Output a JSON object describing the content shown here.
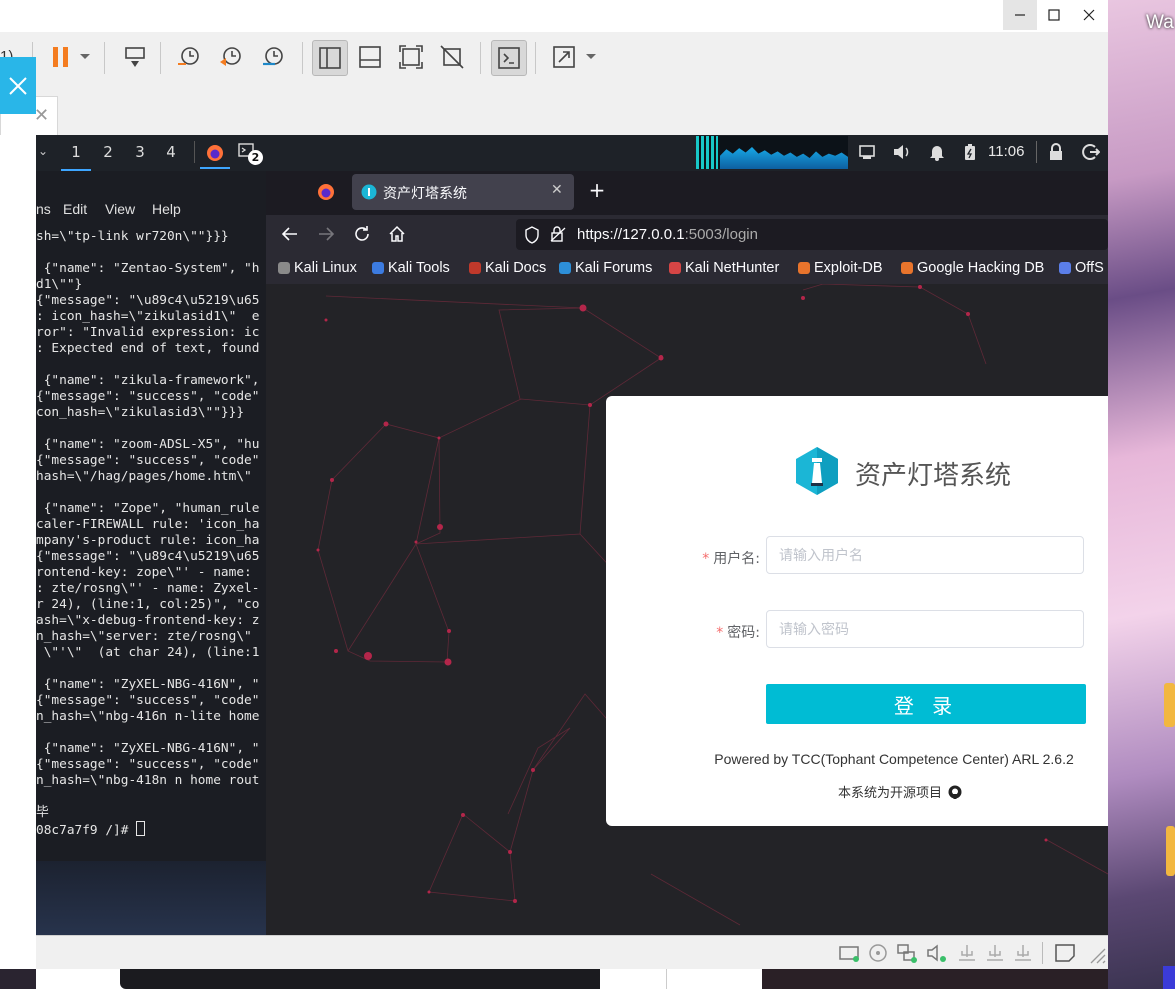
{
  "wallpaper": {
    "text": "Wa"
  },
  "vmware": {
    "toolbar": {
      "partial_label": "1)"
    },
    "statusbar": {}
  },
  "kali_panel": {
    "workspaces": [
      "1",
      "2",
      "3",
      "4"
    ],
    "terminal_badge": "2",
    "clock": "11:06"
  },
  "terminal": {
    "menu": [
      "ns",
      "Edit",
      "View",
      "Help"
    ],
    "lines": [
      "sh=\\\"tp-link wr720n\\\"\"}}}",
      "",
      " {\"name\": \"Zentao-System\", \"h",
      "d1\\\"\"}",
      "{\"message\": \"\\u89c4\\u5219\\u65",
      ": icon_hash=\\\"zikulasid1\\\"  e",
      "ror\": \"Invalid expression: ic",
      ": Expected end of text, found",
      "",
      " {\"name\": \"zikula-framework\",",
      "{\"message\": \"success\", \"code\"",
      "con_hash=\\\"zikulasid3\\\"\"}}}",
      "",
      " {\"name\": \"zoom-ADSL-X5\", \"hu",
      "{\"message\": \"success\", \"code\"",
      "hash=\\\"/hag/pages/home.htm\\\"",
      "",
      " {\"name\": \"Zope\", \"human_rule",
      "caler-FIREWALL rule: 'icon_ha",
      "mpany's-product rule: icon_ha",
      "{\"message\": \"\\u89c4\\u5219\\u65",
      "rontend-key: zope\\\"' - name:",
      ": zte/rosng\\\"' - name: Zyxel-",
      "r 24), (line:1, col:25)\", \"co",
      "ash=\\\"x-debug-frontend-key: z",
      "n_hash=\\\"server: zte/rosng\\\"",
      " \\\"'\\\"  (at char 24), (line:1",
      "",
      " {\"name\": \"ZyXEL-NBG-416N\", \"",
      "{\"message\": \"success\", \"code\"",
      "n_hash=\\\"nbg-416n n-lite home",
      "",
      " {\"name\": \"ZyXEL-NBG-416N\", \"",
      "{\"message\": \"success\", \"code\"",
      "n_hash=\\\"nbg-418n n home rout",
      "",
      "毕",
      "08c7a7f9 /]# "
    ]
  },
  "firefox": {
    "tab_title": "资产灯塔系统",
    "url_host": "https://127.0.0.1",
    "url_rest": ":5003/login",
    "bookmarks": [
      "Kali Linux",
      "Kali Tools",
      "Kali Docs",
      "Kali Forums",
      "Kali NetHunter",
      "Exploit-DB",
      "Google Hacking DB",
      "OffS"
    ]
  },
  "login": {
    "title": "资产灯塔系统",
    "username_label": "用户名:",
    "username_placeholder": "请输入用户名",
    "password_label": "密码:",
    "password_placeholder": "请输入密码",
    "login_button": "登 录",
    "powered_by": "Powered by TCC(Tophant Competence Center) ARL 2.6.2",
    "open_source": "本系统为开源项目"
  },
  "colors": {
    "accent": "#00bcd4",
    "required": "#f56c6c",
    "vm_close": "#29b6e8"
  }
}
